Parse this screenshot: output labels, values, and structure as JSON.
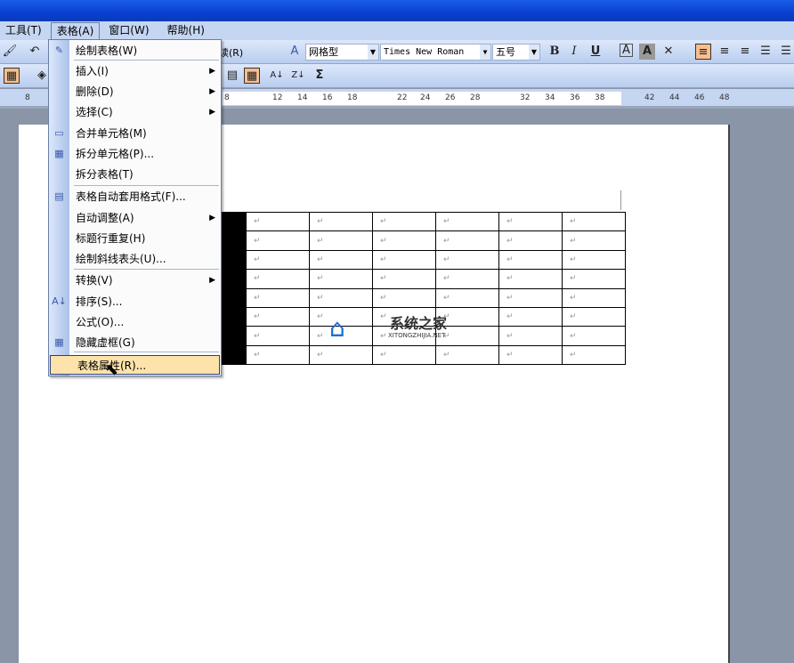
{
  "menubar": {
    "items": [
      "工具(T)",
      "表格(A)",
      "窗口(W)",
      "帮助(H)"
    ],
    "open": "表格(A)"
  },
  "toolbar": {
    "partial_label": "读(R)",
    "style": "网格型",
    "font": "Times New Roman",
    "size": "五号",
    "bold": "B",
    "italic": "I",
    "underline": "U",
    "sum": "Σ"
  },
  "ruler": {
    "ticks": [
      "8",
      "8",
      "12",
      "14",
      "16",
      "18",
      "22",
      "24",
      "26",
      "28",
      "32",
      "34",
      "36",
      "38",
      "42",
      "44",
      "46",
      "48"
    ]
  },
  "table_menu": {
    "items": [
      {
        "label": "绘制表格(W)",
        "icon": "draw-table-icon"
      },
      {
        "label": "插入(I)",
        "submenu": true
      },
      {
        "label": "删除(D)",
        "submenu": true
      },
      {
        "label": "选择(C)",
        "submenu": true
      },
      {
        "label": "合并单元格(M)",
        "icon": "merge-cells-icon"
      },
      {
        "label": "拆分单元格(P)...",
        "icon": "split-cells-icon"
      },
      {
        "label": "拆分表格(T)"
      },
      {
        "label": "表格自动套用格式(F)...",
        "icon": "autoformat-icon"
      },
      {
        "label": "自动调整(A)",
        "submenu": true
      },
      {
        "label": "标题行重复(H)"
      },
      {
        "label": "绘制斜线表头(U)..."
      },
      {
        "label": "转换(V)",
        "submenu": true
      },
      {
        "label": "排序(S)...",
        "icon": "sort-icon"
      },
      {
        "label": "公式(O)..."
      },
      {
        "label": "隐藏虚框(G)",
        "icon": "gridlines-icon"
      },
      {
        "label": "表格属性(R)...",
        "highlighted": true
      }
    ]
  },
  "document": {
    "cell_mark": "↵",
    "rows": 8,
    "cols": 6
  },
  "watermark": {
    "title": "系统之家",
    "subtitle": "XITONGZHIJIA.NET"
  }
}
